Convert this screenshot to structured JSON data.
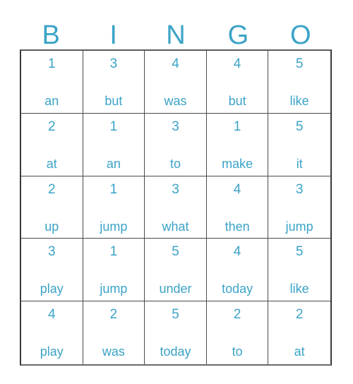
{
  "card": {
    "title": "BINGO",
    "accent_color": "#3BA3C7",
    "grid_line_color": "#4a4a4a",
    "background_color": "#ffffff",
    "headers": [
      "B",
      "I",
      "N",
      "G",
      "O"
    ],
    "rows": [
      [
        {
          "number": "1",
          "word": "an"
        },
        {
          "number": "3",
          "word": "but"
        },
        {
          "number": "4",
          "word": "was"
        },
        {
          "number": "4",
          "word": "but"
        },
        {
          "number": "5",
          "word": "like"
        }
      ],
      [
        {
          "number": "2",
          "word": "at"
        },
        {
          "number": "1",
          "word": "an"
        },
        {
          "number": "3",
          "word": "to"
        },
        {
          "number": "1",
          "word": "make"
        },
        {
          "number": "5",
          "word": "it"
        }
      ],
      [
        {
          "number": "2",
          "word": "up"
        },
        {
          "number": "1",
          "word": "jump"
        },
        {
          "number": "3",
          "word": "what"
        },
        {
          "number": "4",
          "word": "then"
        },
        {
          "number": "3",
          "word": "jump"
        }
      ],
      [
        {
          "number": "3",
          "word": "play"
        },
        {
          "number": "1",
          "word": "jump"
        },
        {
          "number": "5",
          "word": "under"
        },
        {
          "number": "4",
          "word": "today"
        },
        {
          "number": "5",
          "word": "like"
        }
      ],
      [
        {
          "number": "4",
          "word": "play"
        },
        {
          "number": "2",
          "word": "was"
        },
        {
          "number": "5",
          "word": "today"
        },
        {
          "number": "2",
          "word": "to"
        },
        {
          "number": "2",
          "word": "at"
        }
      ]
    ]
  }
}
